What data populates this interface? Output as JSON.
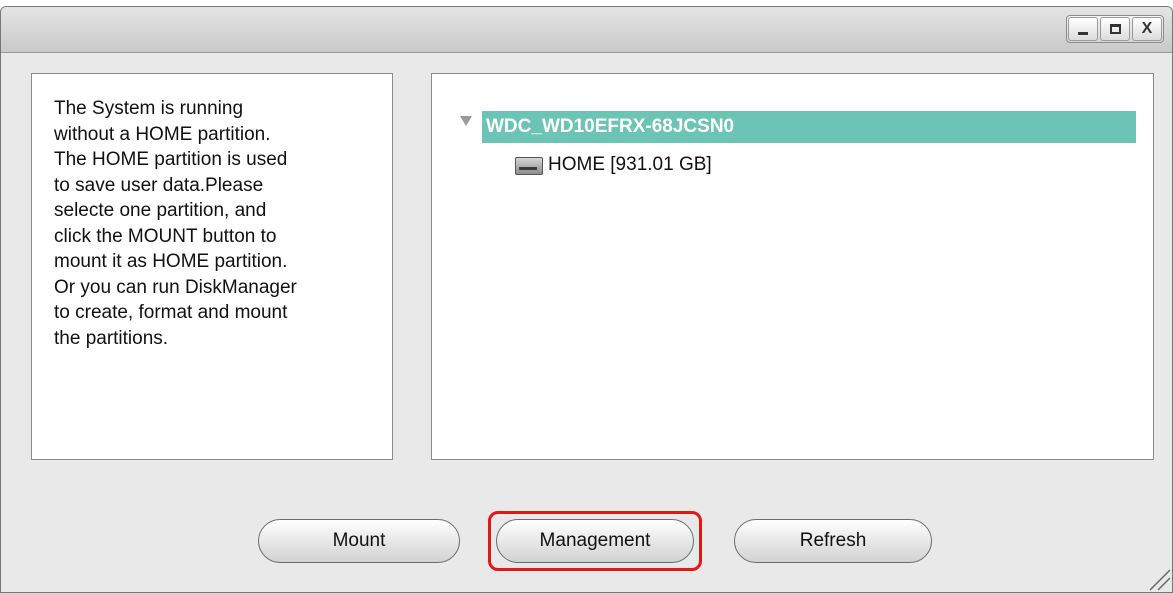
{
  "window": {
    "controls": {
      "minimize": "minimize",
      "maximize": "maximize",
      "close": "X"
    }
  },
  "info": {
    "lines": [
      "The System is running",
      "without a HOME partition.",
      "The HOME partition is used",
      "to save user data.Please",
      "selecte one partition, and",
      "click the MOUNT button to",
      "mount it as HOME partition.",
      "Or you can run DiskManager",
      "to create, format and mount",
      "the partitions."
    ]
  },
  "tree": {
    "root_label": "WDC_WD10EFRX-68JCSN0",
    "child_label": "HOME [931.01 GB]",
    "child_icon": "hard-disk-icon",
    "expand_icon": "expand-arrow-icon"
  },
  "buttons": {
    "mount": "Mount",
    "management": "Management",
    "refresh": "Refresh"
  },
  "colors": {
    "selection": "#6cc4b5",
    "highlight": "#e01818",
    "window_bg": "#e9e9e9"
  }
}
